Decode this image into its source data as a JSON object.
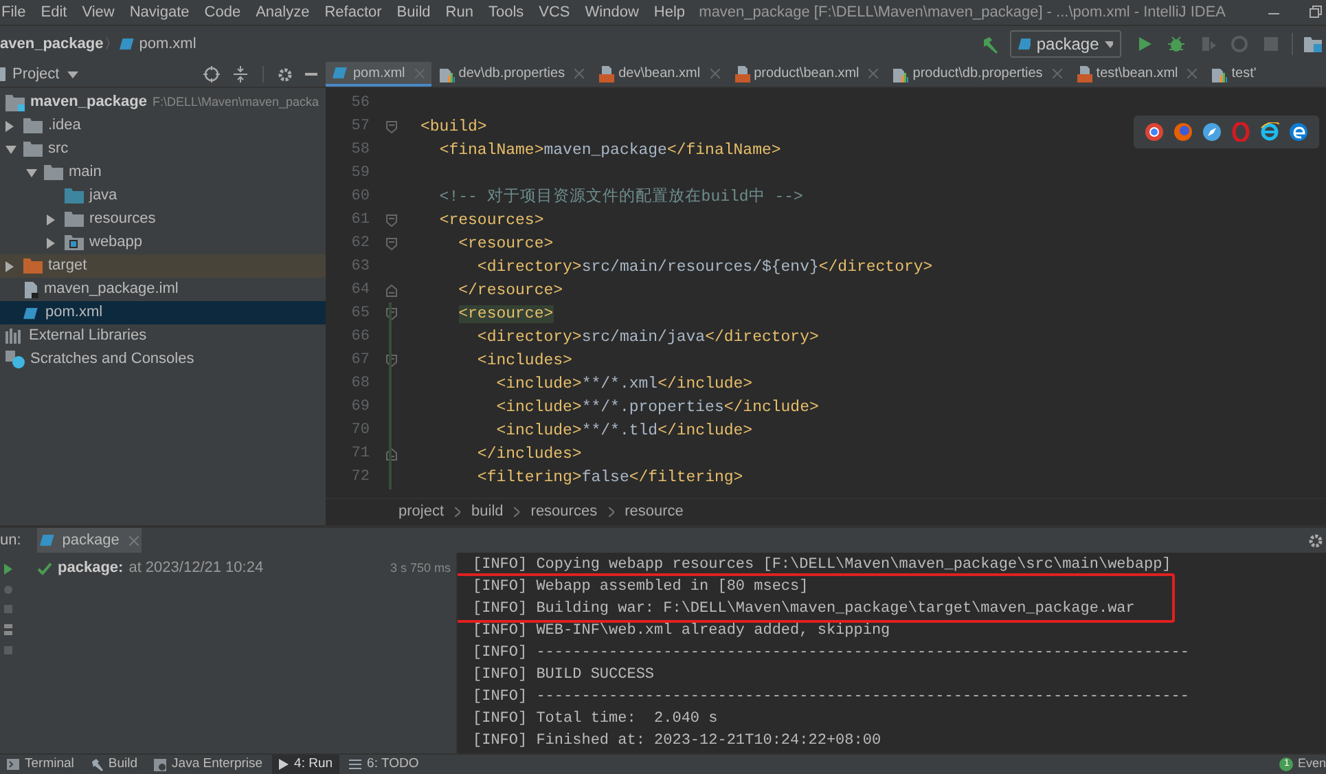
{
  "window": {
    "title": "maven_package [F:\\DELL\\Maven\\maven_package] - ...\\pom.xml - IntelliJ IDEA"
  },
  "menu": [
    "File",
    "Edit",
    "View",
    "Navigate",
    "Code",
    "Analyze",
    "Refactor",
    "Build",
    "Run",
    "Tools",
    "VCS",
    "Window",
    "Help"
  ],
  "nav_bar": {
    "project": "aven_package",
    "separator": "〉",
    "file": "pom.xml",
    "run_config": "package"
  },
  "project_panel": {
    "title": "Project",
    "tree": [
      {
        "label": "maven_package",
        "path": "F:\\DELL\\Maven\\maven_packa",
        "kind": "module",
        "selected": false,
        "children": [
          {
            "label": ".idea",
            "kind": "folder",
            "expanded": false,
            "selected": false
          },
          {
            "label": "src",
            "kind": "folder",
            "expanded": true,
            "selected": false,
            "children": [
              {
                "label": "main",
                "kind": "folder",
                "expanded": true,
                "selected": false,
                "children": [
                  {
                    "label": "java",
                    "kind": "source-folder",
                    "selected": false
                  },
                  {
                    "label": "resources",
                    "kind": "folder",
                    "expanded": false,
                    "selected": false
                  },
                  {
                    "label": "webapp",
                    "kind": "web-folder",
                    "expanded": false,
                    "selected": false
                  }
                ]
              }
            ]
          },
          {
            "label": "target",
            "kind": "excluded-folder",
            "expanded": false,
            "selected": false
          },
          {
            "label": "maven_package.iml",
            "kind": "iml",
            "selected": false
          },
          {
            "label": "pom.xml",
            "kind": "maven",
            "selected": true
          }
        ]
      },
      {
        "label": "External Libraries",
        "kind": "libraries",
        "selected": false
      },
      {
        "label": "Scratches and Consoles",
        "kind": "scratches",
        "selected": false
      }
    ]
  },
  "tabs": [
    {
      "label": "pom.xml",
      "kind": "maven",
      "selected": true
    },
    {
      "label": "dev\\db.properties",
      "kind": "properties",
      "selected": false
    },
    {
      "label": "dev\\bean.xml",
      "kind": "xml",
      "selected": false
    },
    {
      "label": "product\\bean.xml",
      "kind": "xml",
      "selected": false
    },
    {
      "label": "product\\db.properties",
      "kind": "properties",
      "selected": false
    },
    {
      "label": "test\\bean.xml",
      "kind": "xml",
      "selected": false
    },
    {
      "label": "test'",
      "kind": "properties",
      "selected": false
    }
  ],
  "editor": {
    "lines": [
      {
        "number": "56",
        "fold_start": false,
        "fold_end": false,
        "changed": false,
        "tag_match": false
      },
      {
        "number": "57",
        "text": "<build>",
        "kind": "code",
        "fold_start": true,
        "fold_end": false,
        "changed": false,
        "tag_match": false
      },
      {
        "number": "58",
        "text": "  <finalName>maven_package</finalName>",
        "kind": "code",
        "fold_start": false,
        "fold_end": false,
        "changed": false,
        "tag_match": false
      },
      {
        "number": "59",
        "fold_start": false,
        "fold_end": false,
        "changed": false,
        "tag_match": false
      },
      {
        "number": "60",
        "text": "  <!-- 对于项目资源文件的配置放在build中 -->",
        "kind": "comment",
        "fold_start": false,
        "fold_end": false,
        "changed": false,
        "tag_match": false
      },
      {
        "number": "61",
        "text": "  <resources>",
        "kind": "code",
        "fold_start": true,
        "fold_end": false,
        "changed": false,
        "tag_match": false
      },
      {
        "number": "62",
        "text": "    <resource>",
        "kind": "code",
        "fold_start": true,
        "fold_end": false,
        "changed": false,
        "tag_match": false
      },
      {
        "number": "63",
        "text": "      <directory>src/main/resources/${env}</directory>",
        "kind": "code",
        "fold_start": false,
        "fold_end": false,
        "changed": false,
        "tag_match": false
      },
      {
        "number": "64",
        "text": "    </resource>",
        "kind": "code",
        "fold_start": false,
        "fold_end": true,
        "changed": false,
        "tag_match": false
      },
      {
        "number": "65",
        "text": "    <resource>",
        "kind": "code",
        "fold_start": true,
        "fold_end": false,
        "changed": true,
        "tag_match": true
      },
      {
        "number": "66",
        "text": "      <directory>src/main/java</directory>",
        "kind": "code",
        "fold_start": false,
        "fold_end": false,
        "changed": true,
        "tag_match": false
      },
      {
        "number": "67",
        "text": "      <includes>",
        "kind": "code",
        "fold_start": true,
        "fold_end": false,
        "changed": true,
        "tag_match": false
      },
      {
        "number": "68",
        "text": "        <include>**/*.xml</include>",
        "kind": "code",
        "fold_start": false,
        "fold_end": false,
        "changed": true,
        "tag_match": false
      },
      {
        "number": "69",
        "text": "        <include>**/*.properties</include>",
        "kind": "code",
        "fold_start": false,
        "fold_end": false,
        "changed": true,
        "tag_match": false
      },
      {
        "number": "70",
        "text": "        <include>**/*.tld</include>",
        "kind": "code",
        "fold_start": false,
        "fold_end": false,
        "changed": true,
        "tag_match": false
      },
      {
        "number": "71",
        "text": "      </includes>",
        "kind": "code",
        "fold_start": false,
        "fold_end": true,
        "changed": true,
        "tag_match": false
      },
      {
        "number": "72",
        "text": "      <filtering>false</filtering>",
        "kind": "code",
        "fold_start": false,
        "fold_end": false,
        "changed": true,
        "tag_match": false
      }
    ],
    "breadcrumb": [
      "project",
      "build",
      "resources",
      "resource"
    ]
  },
  "run_panel": {
    "label": "un:",
    "tab": "package",
    "task": {
      "name": "package:",
      "time": "at 2023/12/21 10:24",
      "duration": "3 s 750 ms",
      "success": true
    },
    "console": [
      "[INFO] Copying webapp resources [F:\\DELL\\Maven\\maven_package\\src\\main\\webapp]",
      "[INFO] Webapp assembled in [80 msecs]",
      "[INFO] Building war: F:\\DELL\\Maven\\maven_package\\target\\maven_package.war",
      "[INFO] WEB-INF\\web.xml already added, skipping",
      "[INFO] ------------------------------------------------------------------------",
      "[INFO] BUILD SUCCESS",
      "[INFO] ------------------------------------------------------------------------",
      "[INFO] Total time:  2.040 s",
      "[INFO] Finished at: 2023-12-21T10:24:22+08:00"
    ]
  },
  "bottom_bar": {
    "tools": [
      {
        "label": "Terminal",
        "kind": "terminal",
        "selected": false
      },
      {
        "label": "Build",
        "kind": "build",
        "selected": false
      },
      {
        "label": "Java Enterprise",
        "kind": "enterprise",
        "selected": false
      },
      {
        "label": "4: Run",
        "kind": "run",
        "selected": true
      },
      {
        "label": "6: TODO",
        "kind": "todo",
        "selected": false
      }
    ],
    "event_count": "1",
    "event_label": "Even"
  }
}
